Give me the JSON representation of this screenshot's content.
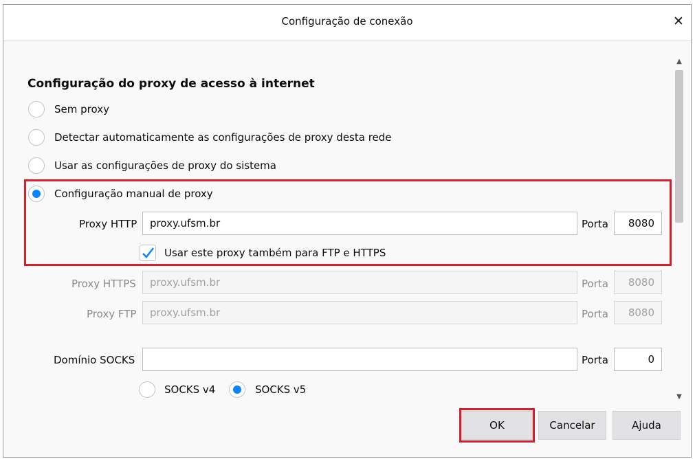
{
  "window": {
    "title": "Configuração de conexão",
    "close_glyph": "✕"
  },
  "section": {
    "heading": "Configuração do proxy de acesso à internet"
  },
  "options": {
    "no_proxy": "Sem proxy",
    "auto_detect": "Detectar automaticamente as configurações de proxy desta rede",
    "system": "Usar as configurações de proxy do sistema",
    "manual": "Configuração manual de proxy"
  },
  "http": {
    "label": "Proxy HTTP",
    "value": "proxy.ufsm.br",
    "port_label": "Porta",
    "port": "8080"
  },
  "share": {
    "label": "Usar este proxy também para FTP e HTTPS",
    "checked": true
  },
  "https": {
    "label": "Proxy HTTPS",
    "value": "proxy.ufsm.br",
    "port_label": "Porta",
    "port": "8080"
  },
  "ftp": {
    "label": "Proxy FTP",
    "value": "proxy.ufsm.br",
    "port_label": "Porta",
    "port": "8080"
  },
  "socks": {
    "label": "Domínio SOCKS",
    "value": "",
    "port_label": "Porta",
    "port": "0",
    "v4": "SOCKS v4",
    "v5": "SOCKS v5",
    "selected": "SOCKS v5"
  },
  "buttons": {
    "ok": "OK",
    "cancel": "Cancelar",
    "help": "Ajuda"
  },
  "colors": {
    "accent": "#0a84ff",
    "highlight": "#d61f2c"
  },
  "icons": {
    "close": "close-icon",
    "check": "checkmark-icon",
    "scroll_up": "chevron-up-icon",
    "scroll_down": "chevron-down-icon"
  }
}
